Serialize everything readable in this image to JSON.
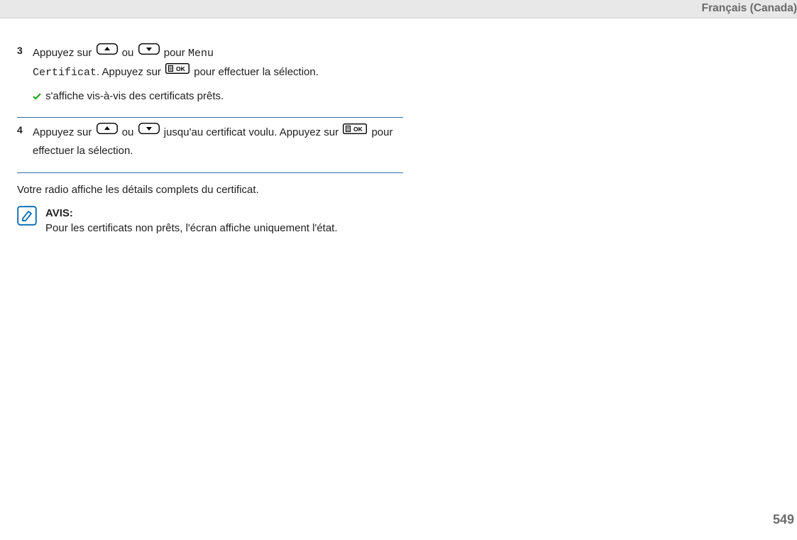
{
  "header": {
    "locale": "Français (Canada)"
  },
  "step3": {
    "num": "3",
    "t1a": "Appuyez sur ",
    "t1b": " ou ",
    "t1c": " pour ",
    "menuWord": "Menu",
    "certWord": "Certificat",
    "t2a": ". Appuyez sur ",
    "t2b": " pour effectuer la sélection.",
    "sub": " s'affiche vis-à-vis des certificats prêts."
  },
  "step4": {
    "num": "4",
    "t1a": "Appuyez sur ",
    "t1b": " ou ",
    "t1c": " jusqu'au certificat voulu. Appuyez sur ",
    "t1d": " pour effectuer la sélection."
  },
  "after": "Votre radio affiche les détails complets du certificat.",
  "note": {
    "title": "AVIS:",
    "body": "Pour les certificats non prêts, l'écran affiche uniquement l'état."
  },
  "pageNumber": "549"
}
